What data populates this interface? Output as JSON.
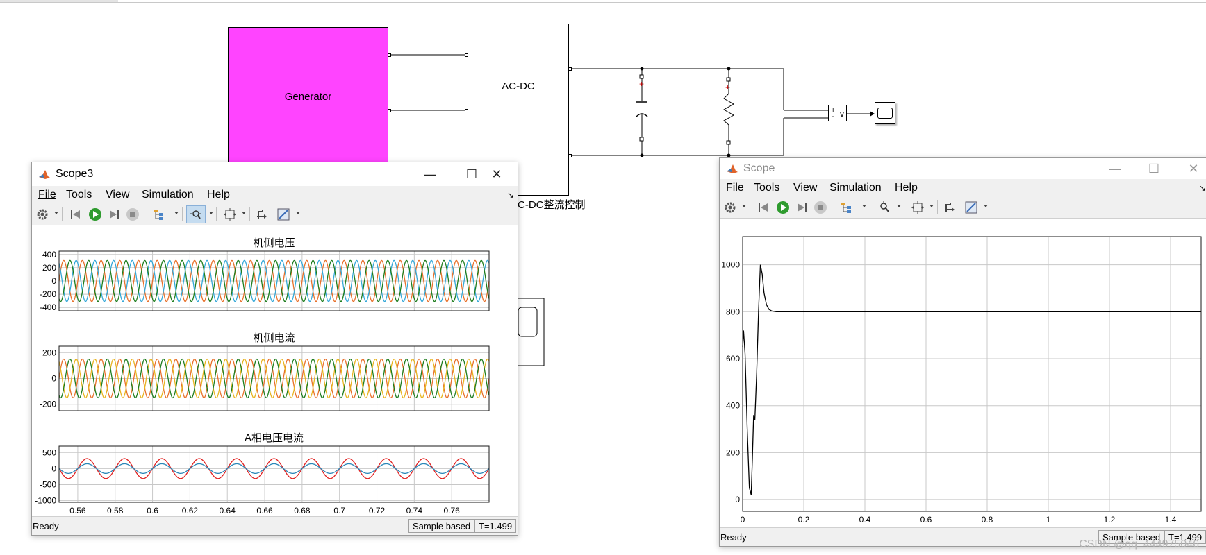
{
  "model": {
    "generator_label": "Generator",
    "acdc_label": "AC-DC",
    "control_label": "AC-DC整流控制",
    "voltmeter_plus": "+",
    "voltmeter_minus": "-",
    "voltmeter_v": "v"
  },
  "scope3": {
    "title": "Scope3",
    "menu": [
      "File",
      "Tools",
      "View",
      "Simulation",
      "Help"
    ],
    "status": "Ready",
    "sample_mode": "Sample based",
    "time": "T=1.499",
    "min_glyph": "—",
    "max_glyph": "☐",
    "close_glyph": "✕"
  },
  "scope": {
    "title": "Scope",
    "menu": [
      "File",
      "Tools",
      "View",
      "Simulation",
      "Help"
    ],
    "status": "Ready",
    "sample_mode": "Sample based",
    "time": "T=1.499",
    "min_glyph": "—",
    "max_glyph": "☐",
    "close_glyph": "✕"
  },
  "watermark": "CSDN @qq_444975046",
  "colors": {
    "generator": "#ff44ff",
    "phase_a": "#e8702a",
    "phase_b": "#35a8d8",
    "phase_c": "#1e7d1e",
    "phase_c_current": "#e8b420",
    "a_voltage": "#e02020",
    "a_current": "#2a86b8"
  },
  "chart_data": [
    {
      "type": "line",
      "title": "机侧电压",
      "x": {
        "start": 0.55,
        "end": 0.78,
        "ticks": [
          0.56,
          0.58,
          0.6,
          0.62,
          0.64,
          0.66,
          0.68,
          0.7,
          0.72,
          0.74,
          0.76
        ]
      },
      "ylim": [
        -450,
        450
      ],
      "yticks": [
        400,
        200,
        0,
        -200,
        -400
      ],
      "grid": true,
      "series": [
        {
          "amplitude": 310,
          "frequency_hz": 100,
          "phase_deg": 0,
          "color": "#e8702a"
        },
        {
          "amplitude": 310,
          "frequency_hz": 100,
          "phase_deg": 120,
          "color": "#35a8d8"
        },
        {
          "amplitude": 310,
          "frequency_hz": 100,
          "phase_deg": 240,
          "color": "#1e7d1e"
        }
      ]
    },
    {
      "type": "line",
      "title": "机侧电流",
      "x": {
        "start": 0.55,
        "end": 0.78,
        "ticks": [
          0.56,
          0.58,
          0.6,
          0.62,
          0.64,
          0.66,
          0.68,
          0.7,
          0.72,
          0.74,
          0.76
        ]
      },
      "ylim": [
        -250,
        250
      ],
      "yticks": [
        200,
        0,
        -200
      ],
      "grid": true,
      "series": [
        {
          "amplitude": 150,
          "frequency_hz": 100,
          "phase_deg": 0,
          "color": "#e8702a"
        },
        {
          "amplitude": 150,
          "frequency_hz": 100,
          "phase_deg": 120,
          "color": "#e8b420"
        },
        {
          "amplitude": 150,
          "frequency_hz": 100,
          "phase_deg": 240,
          "color": "#1e7d1e"
        }
      ]
    },
    {
      "type": "line",
      "title": "A相电压电流",
      "x": {
        "start": 0.55,
        "end": 0.78,
        "ticks": [
          0.56,
          0.58,
          0.6,
          0.62,
          0.64,
          0.66,
          0.68,
          0.7,
          0.72,
          0.74,
          0.76
        ],
        "tick_labels": [
          "0.56",
          "0.58",
          "0.6",
          "0.62",
          "0.64",
          "0.66",
          "0.68",
          "0.7",
          "0.72",
          "0.74",
          "0.76"
        ]
      },
      "ylim": [
        -1050,
        700
      ],
      "yticks": [
        500,
        0,
        -500,
        -1000
      ],
      "grid": true,
      "series": [
        {
          "amplitude": 310,
          "frequency_hz": 50,
          "phase_deg": 0,
          "color": "#e02020"
        },
        {
          "amplitude": 150,
          "frequency_hz": 50,
          "phase_deg": 0,
          "color": "#2a86b8"
        }
      ]
    },
    {
      "type": "line",
      "title": "",
      "x": {
        "start": 0,
        "end": 1.5,
        "ticks": [
          0,
          0.2,
          0.4,
          0.6,
          0.8,
          1,
          1.2,
          1.4
        ],
        "tick_labels": [
          "0",
          "0.2",
          "0.4",
          "0.6",
          "0.8",
          "1",
          "1.2",
          "1.4"
        ]
      },
      "ylim": [
        -50,
        1120
      ],
      "yticks": [
        1000,
        800,
        600,
        400,
        200,
        0
      ],
      "grid": true,
      "series": [
        {
          "color": "#000000",
          "x": [
            0,
            0.003,
            0.008,
            0.015,
            0.022,
            0.028,
            0.032,
            0.036,
            0.04,
            0.046,
            0.052,
            0.058,
            0.064,
            0.07,
            0.078,
            0.086,
            0.095,
            0.11,
            0.13,
            0.16,
            0.2,
            0.3,
            0.5,
            0.8,
            1.0,
            1.2,
            1.4,
            1.499
          ],
          "y": [
            650,
            720,
            620,
            300,
            50,
            20,
            180,
            360,
            340,
            540,
            800,
            1000,
            960,
            880,
            830,
            810,
            803,
            800,
            800,
            800,
            800,
            800,
            800,
            800,
            800,
            800,
            800,
            800
          ]
        }
      ]
    }
  ]
}
